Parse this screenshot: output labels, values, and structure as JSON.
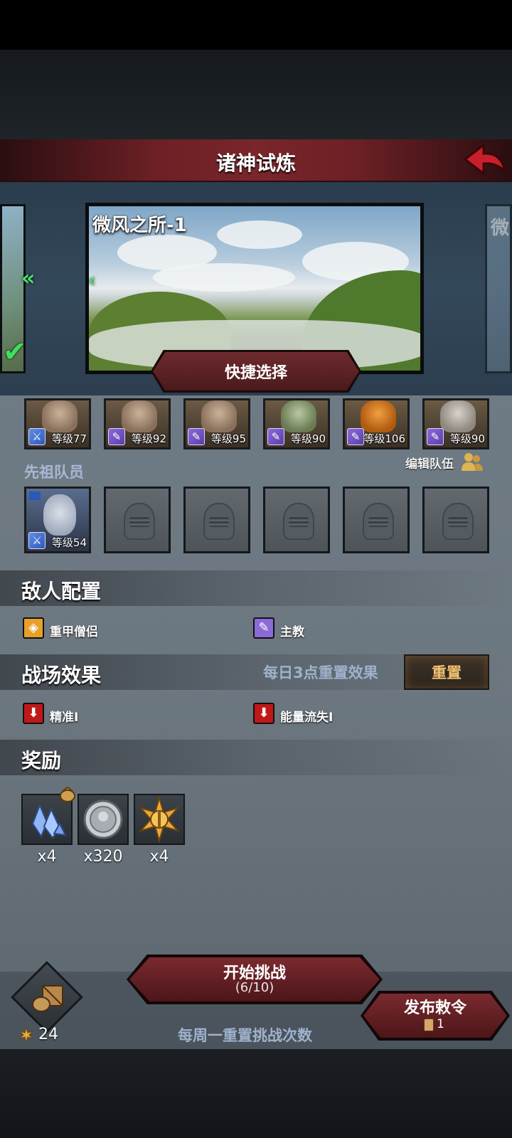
{
  "header": {
    "title": "诸神试炼"
  },
  "stage": {
    "current_name": "微风之所-1",
    "next_name_partial": "微",
    "quick_select_label": "快捷选择"
  },
  "main_heroes": [
    {
      "role": "blue",
      "level": "等级77"
    },
    {
      "role": "purple",
      "level": "等级92"
    },
    {
      "role": "purple",
      "level": "等级95"
    },
    {
      "role": "purple",
      "level": "等级90"
    },
    {
      "role": "purple",
      "level": "等级106"
    },
    {
      "role": "purple",
      "level": "等级90"
    }
  ],
  "ancestor": {
    "label": "先祖队员",
    "edit_label": "编辑队伍",
    "hero_level": "等级54"
  },
  "enemy": {
    "title": "敌人配置",
    "items": [
      {
        "icon": "shield-icon",
        "name": "重甲僧侣"
      },
      {
        "icon": "staff-icon",
        "name": "主教"
      }
    ]
  },
  "battlefield": {
    "title": "战场效果",
    "reset_note": "每日3点重置效果",
    "reset_label": "重置",
    "effects": [
      {
        "icon": "down-arrow-icon",
        "name": "精准I"
      },
      {
        "icon": "down-arrow-icon",
        "name": "能量流失I"
      }
    ]
  },
  "rewards": {
    "title": "奖励",
    "items": [
      {
        "icon": "crystal-icon",
        "count": "x4"
      },
      {
        "icon": "silver-coin-icon",
        "count": "x320"
      },
      {
        "icon": "sun-medal-icon",
        "count": "x4"
      }
    ]
  },
  "bottom": {
    "start_label": "开始挑战",
    "start_count": "(6/10)",
    "weekly_note": "每周一重置挑战次数",
    "decree_label": "发布敕令",
    "decree_count": "1",
    "currency_count": "24"
  },
  "colors": {
    "accent_red": "#6b2025",
    "label_blue": "#a6b8d6",
    "reset_gold": "#f3c271",
    "chevron_green": "#4de06a"
  }
}
